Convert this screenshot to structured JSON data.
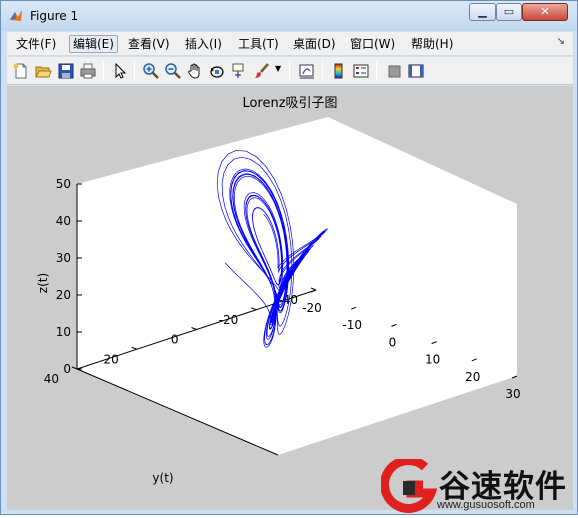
{
  "window": {
    "title": "Figure 1",
    "buttons": {
      "minimize": "▁",
      "maximize": "▭",
      "close": "✕"
    }
  },
  "menubar": {
    "items": [
      "文件(F)",
      "编辑(E)",
      "查看(V)",
      "插入(I)",
      "工具(T)",
      "桌面(D)",
      "窗口(W)",
      "帮助(H)"
    ],
    "active_index": 1
  },
  "toolbar": {
    "icons": [
      "new-file-icon",
      "open-folder-icon",
      "save-icon",
      "print-icon",
      "pointer-icon",
      "zoom-in-icon",
      "zoom-out-icon",
      "pan-hand-icon",
      "rotate-3d-icon",
      "data-cursor-icon",
      "brush-icon",
      "link-plot-icon",
      "colorbar-icon",
      "legend-icon",
      "hide-plot-tools-icon",
      "show-plot-tools-icon"
    ]
  },
  "chart_data": {
    "type": "line",
    "title": "Lorenz吸引子图",
    "xlabel": "",
    "ylabel": "y(t)",
    "zlabel": "z(t)",
    "xlim": [
      -20,
      30
    ],
    "ylim": [
      -40,
      40
    ],
    "zlim": [
      0,
      50
    ],
    "x_ticks": [
      "-20",
      "-10",
      "0",
      "10",
      "20",
      "30"
    ],
    "y_ticks": [
      "40",
      "20",
      "0",
      "-20",
      "-40"
    ],
    "z_ticks": [
      "50",
      "40",
      "30",
      "20",
      "10",
      "0"
    ],
    "series": [
      {
        "color": "#0000ff"
      }
    ]
  },
  "watermark": {
    "chinese": "谷速软件",
    "url": "www.gusuosoft.com",
    "logo_colors": [
      "#e02020",
      "#2a2a2a"
    ]
  }
}
